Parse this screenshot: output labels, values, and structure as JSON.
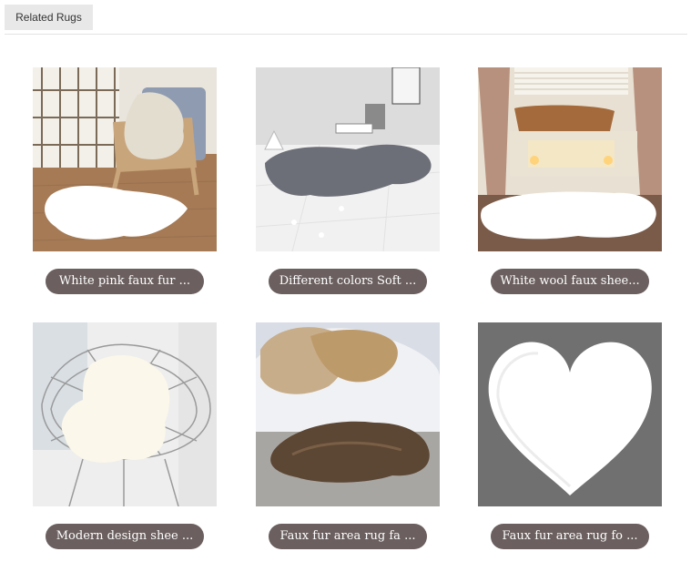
{
  "tabs": {
    "related_rugs": "Related Rugs"
  },
  "products": [
    {
      "title": "White pink faux fur ...",
      "image": "white-sheepskin-rug-on-wood-floor-photo"
    },
    {
      "title": "Different colors Soft ...",
      "image": "grey-fur-rug-on-marble-floor-photo"
    },
    {
      "title": "White wool faux shee...",
      "image": "white-fur-rug-bathroom-photo"
    },
    {
      "title": "Modern design shee ...",
      "image": "white-sheepskin-on-wire-chair-photo"
    },
    {
      "title": "Faux fur area rug fa ...",
      "image": "brown-faux-fur-rug-bedroom-photo"
    },
    {
      "title": "Faux fur area rug fo ...",
      "image": "white-heart-shaped-rug-photo"
    }
  ]
}
